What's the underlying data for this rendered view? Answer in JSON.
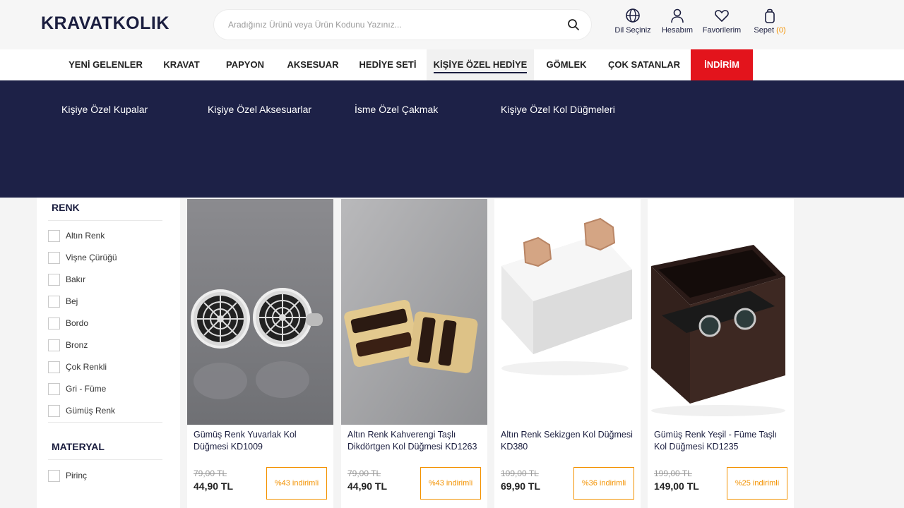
{
  "header": {
    "logo": "KRAVATKOLIK",
    "search_placeholder": "Aradığınız Ürünü veya Ürün Kodunu Yazınız...",
    "language_label": "Dil Seçiniz",
    "account_label": "Hesabım",
    "favorites_label": "Favorilerim",
    "cart_label": "Sepet",
    "cart_count": "(0)"
  },
  "nav": {
    "items": [
      "YENİ GELENLER",
      "KRAVAT",
      "PAPYON",
      "AKSESUAR",
      "HEDİYE SETİ",
      "KİŞİYE ÖZEL HEDİYE",
      "GÖMLEK",
      "ÇOK SATANLAR",
      "İNDİRİM"
    ]
  },
  "mega_menu": {
    "links": [
      "Kişiye Özel Kupalar",
      "Kişiye Özel Aksesuarlar",
      "İsme Özel Çakmak",
      "Kişiye Özel Kol Düğmeleri"
    ]
  },
  "filters": {
    "color": {
      "title": "RENK",
      "options": [
        "Altın Renk",
        "Vişne Çürüğü",
        "Bakır",
        "Bej",
        "Bordo",
        "Bronz",
        "Çok Renkli",
        "Gri - Füme",
        "Gümüş Renk"
      ]
    },
    "material": {
      "title": "MATERYAL",
      "options": [
        "Pirinç"
      ]
    }
  },
  "products": [
    {
      "name": "Gümüş Renk Yuvarlak Kol Düğmesi KD1009",
      "old_price": "79,00 TL",
      "price": "44,90 TL",
      "discount": "%43 indirimli"
    },
    {
      "name": "Altın Renk Kahverengi Taşlı Dikdörtgen Kol Düğmesi KD1263",
      "old_price": "79,00 TL",
      "price": "44,90 TL",
      "discount": "%43 indirimli"
    },
    {
      "name": "Altın Renk Sekizgen Kol Düğmesi KD380",
      "old_price": "109,00 TL",
      "price": "69,90 TL",
      "discount": "%36 indirimli"
    },
    {
      "name": "Gümüş Renk Yeşil - Füme Taşlı Kol Düğmesi KD1235",
      "old_price": "199,00 TL",
      "price": "149,00 TL",
      "discount": "%25 indirimli"
    }
  ],
  "colors": {
    "brand_navy": "#1d2147",
    "sale_red": "#e3141c",
    "accent_orange": "#f39200"
  }
}
